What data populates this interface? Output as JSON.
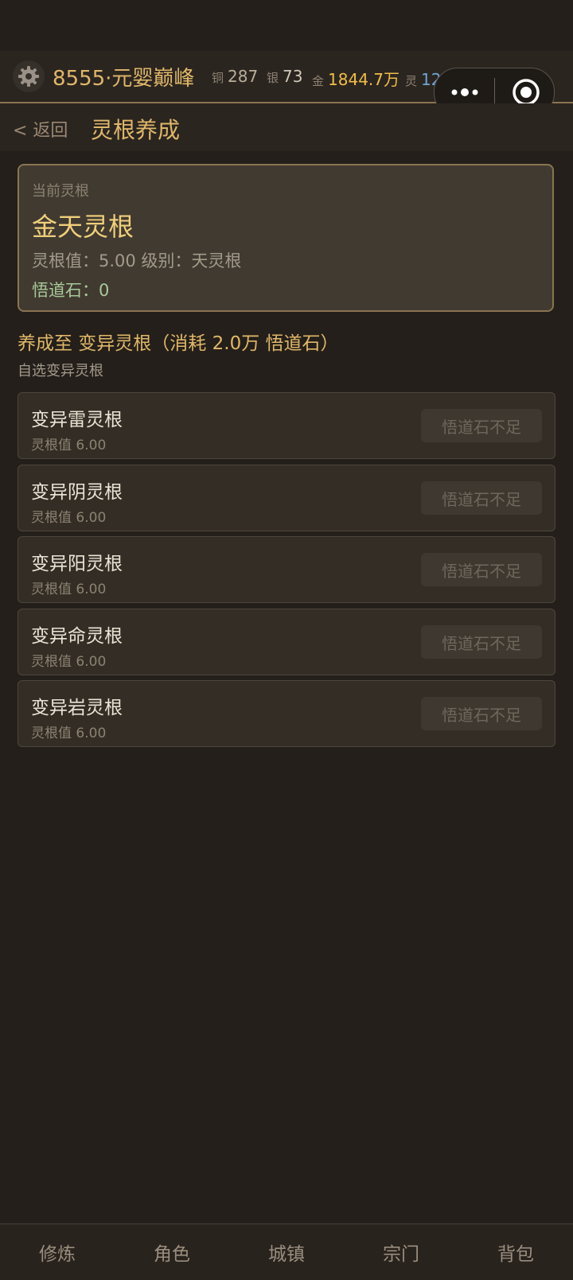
{
  "topbar": {
    "player": "8555·元婴巅峰",
    "currencies": [
      {
        "label": "铜",
        "value": "287"
      },
      {
        "label": "银",
        "value": "73"
      },
      {
        "label": "金",
        "value": "1844.7万"
      },
      {
        "label": "灵",
        "value": "12.2万"
      }
    ],
    "colors": {
      "gold": "#f0bd4a",
      "spirit": "#6fa6d8",
      "accent": "#e0b76a"
    }
  },
  "nav": {
    "back": "< 返回",
    "title": "灵根养成"
  },
  "current": {
    "caption": "当前灵根",
    "name": "金天灵根",
    "stats": "灵根值：5.00  级别：天灵根",
    "stones": "悟道石：0"
  },
  "upgrade": {
    "headline": "养成至 变异灵根（消耗 2.0万 悟道石）",
    "subtitle": "自选变异灵根"
  },
  "options": [
    {
      "name": "变异雷灵根",
      "value": "灵根值 6.00",
      "button": "悟道石不足"
    },
    {
      "name": "变异阴灵根",
      "value": "灵根值 6.00",
      "button": "悟道石不足"
    },
    {
      "name": "变异阳灵根",
      "value": "灵根值 6.00",
      "button": "悟道石不足"
    },
    {
      "name": "变异命灵根",
      "value": "灵根值 6.00",
      "button": "悟道石不足"
    },
    {
      "name": "变异岩灵根",
      "value": "灵根值 6.00",
      "button": "悟道石不足"
    }
  ],
  "bottom_nav": [
    "修炼",
    "角色",
    "城镇",
    "宗门",
    "背包"
  ]
}
